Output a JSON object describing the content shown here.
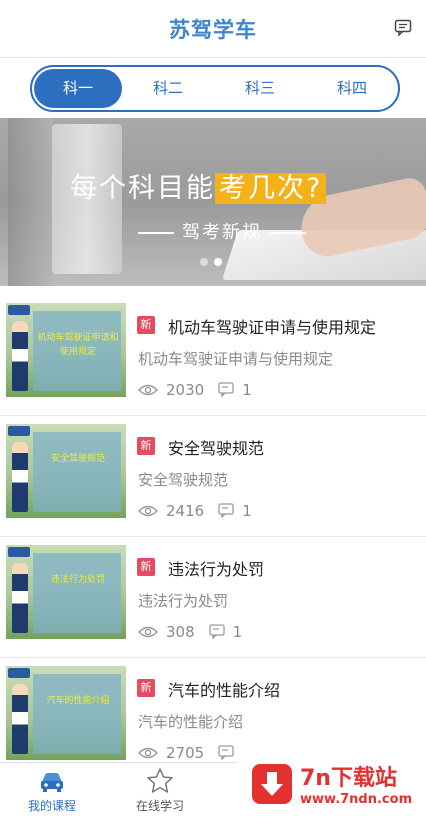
{
  "header": {
    "title": "苏驾学车",
    "message_icon": "message-icon"
  },
  "segments": [
    {
      "label": "科一",
      "active": true
    },
    {
      "label": "科二",
      "active": false
    },
    {
      "label": "科三",
      "active": false
    },
    {
      "label": "科四",
      "active": false
    }
  ],
  "banner": {
    "headline_main": "每个科目能",
    "headline_highlight": "考几次?",
    "subtitle": "驾考新规",
    "highlight_color": "#f3b21a",
    "active_dot": 2,
    "dot_count": 2
  },
  "articles": [
    {
      "tag": "新",
      "title": "机动车驾驶证申请与使用规定",
      "summary": "机动车驾驶证申请与使用规定",
      "views": "2030",
      "comments": "1",
      "thumb_text": "机动车驾驶证申请和使用规定"
    },
    {
      "tag": "新",
      "title": "安全驾驶规范",
      "summary": "安全驾驶规范",
      "views": "2416",
      "comments": "1",
      "thumb_text": "安全驾驶规范"
    },
    {
      "tag": "新",
      "title": "违法行为处罚",
      "summary": "违法行为处罚",
      "views": "308",
      "comments": "1",
      "thumb_text": "违法行为处罚"
    },
    {
      "tag": "新",
      "title": "汽车的性能介绍",
      "summary": "汽车的性能介绍",
      "views": "2705",
      "comments": "",
      "thumb_text": "汽车的性能介绍"
    }
  ],
  "tabbar": {
    "tabs": [
      {
        "label": "我的课程",
        "icon": "car-icon",
        "active": true
      },
      {
        "label": "在线学习",
        "icon": "star-icon",
        "active": false
      }
    ]
  },
  "watermark": {
    "title": "7n下载站",
    "url": "www.7ndn.com"
  },
  "colors": {
    "brand": "#2d6fbf",
    "title": "#3d86c9",
    "new_tag": "#e84a5f",
    "watermark": "#e53030"
  }
}
